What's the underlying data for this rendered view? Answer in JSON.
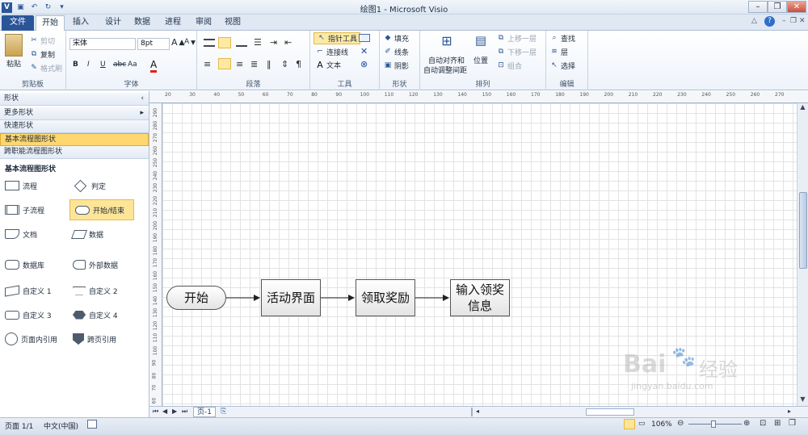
{
  "window": {
    "title": "绘图1 - Microsoft Visio",
    "help": "?"
  },
  "tabs": [
    "文件",
    "开始",
    "插入",
    "设计",
    "数据",
    "进程",
    "审阅",
    "视图"
  ],
  "clipboard": {
    "paste": "粘贴",
    "cut": "剪切",
    "copy": "复制",
    "format_painter": "格式刷",
    "label": "剪贴板"
  },
  "font": {
    "family": "宋体",
    "size": "8pt",
    "bold": "B",
    "italic": "I",
    "underline": "U",
    "strike": "abc",
    "case": "Aa",
    "color": "A",
    "label": "字体"
  },
  "paragraph": {
    "label": "段落"
  },
  "tools": {
    "pointer": "指针工具",
    "connector": "连接线",
    "text": "文本",
    "text_icon": "A",
    "label": "工具"
  },
  "shape_styles": {
    "fill": "填充",
    "line": "线条",
    "shadow": "阴影",
    "label": "形状"
  },
  "arrange": {
    "auto_align": "自动对齐和",
    "auto_space": "自动调整间距",
    "position": "位置",
    "bring_forward": "上移一层",
    "send_backward": "下移一层",
    "group": "组合",
    "label": "排列"
  },
  "editing": {
    "find": "查找",
    "layers": "层",
    "select": "选择",
    "label": "编辑"
  },
  "shapes_panel": {
    "title": "形状",
    "more": "更多形状",
    "quick": "快速形状",
    "basic": "基本流程图形状",
    "cross": "跨职能流程图形状",
    "section": "基本流程图形状",
    "items": [
      "流程",
      "判定",
      "子流程",
      "开始/结束",
      "文档",
      "数据",
      "数据库",
      "外部数据",
      "自定义 1",
      "自定义 2",
      "自定义 3",
      "自定义 4",
      "页面内引用",
      "跨页引用"
    ]
  },
  "diagram": {
    "nodes": [
      "开始",
      "活动界面",
      "领取奖励",
      "输入领奖信息"
    ]
  },
  "ruler": {
    "h": [
      "20",
      "30",
      "40",
      "50",
      "60",
      "70",
      "80",
      "90",
      "100",
      "110",
      "120",
      "130",
      "140",
      "150",
      "160",
      "170",
      "180",
      "190",
      "200",
      "210",
      "220",
      "230",
      "240",
      "250",
      "260",
      "270"
    ],
    "v": [
      "290",
      "280",
      "270",
      "260",
      "250",
      "240",
      "230",
      "220",
      "210",
      "200",
      "190",
      "180",
      "170",
      "160",
      "150",
      "140",
      "130",
      "120",
      "110",
      "100",
      "90",
      "80",
      "70",
      "60"
    ]
  },
  "pages": {
    "current": "页-1"
  },
  "status": {
    "page": "页面 1/1",
    "lang": "中文(中国)",
    "zoom": "106%"
  },
  "watermark": {
    "brand": "Bai",
    "brand2": "经验",
    "url": "jingyan.baidu.com"
  }
}
